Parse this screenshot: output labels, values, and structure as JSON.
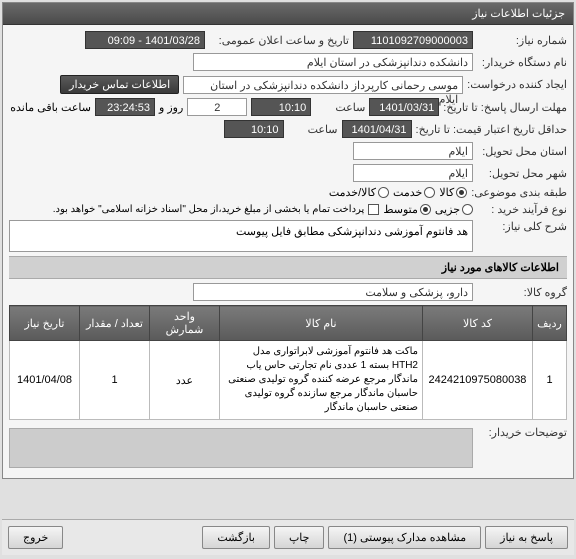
{
  "header": {
    "title": "جزئیات اطلاعات نیاز"
  },
  "fields": {
    "need_no_label": "شماره نیاز:",
    "need_no": "1101092709000003",
    "announce_label": "تاریخ و ساعت اعلان عمومی:",
    "announce_val": "1401/03/28 - 09:09",
    "buyer_label": "نام دستگاه خریدار:",
    "buyer_val": "دانشکده دندانپزشکی در استان ایلام",
    "creator_label": "ایجاد کننده درخواست:",
    "creator_val": "موسی رحمانی کارپرداز دانشکده دندانپزشکی در استان ایلام",
    "contact_btn": "اطلاعات تماس خریدار",
    "deadline_label": "مهلت ارسال پاسخ: تا تاریخ:",
    "deadline_date": "1401/03/31",
    "time_label": "ساعت",
    "deadline_time": "10:10",
    "days_count": "2",
    "days_label": "روز و",
    "countdown": "23:24:53",
    "remain_label": "ساعت باقی مانده",
    "validity_label": "حداقل تاریخ اعتبار قیمت: تا تاریخ:",
    "validity_date": "1401/04/31",
    "validity_time": "10:10",
    "province_label": "استان محل تحویل:",
    "province_val": "ایلام",
    "city_label": "شهر محل تحویل:",
    "city_val": "ایلام",
    "category_label": "طبقه بندی موضوعی:",
    "radio_kala": "کالا",
    "radio_khadamat": "خدمت",
    "radio_kala_khadamat": "کالا/خدمت",
    "process_label": "نوع فرآیند خرید :",
    "radio_jozei": "جزیی",
    "radio_motavaset": "متوسط",
    "payment_note": "پرداخت تمام یا بخشی از مبلغ خرید،از محل \"اسناد خزانه اسلامی\" خواهد بود.",
    "desc_label": "شرح کلی نیاز:",
    "desc_text": "هد فانتوم آموزشی دندانپزشکی مطابق فایل پیوست",
    "items_section": "اطلاعات کالاهای مورد نیاز",
    "group_label": "گروه کالا:",
    "group_val": "دارو، پزشکی و سلامت",
    "buyer_notes_label": "توضیحات خریدار:"
  },
  "table": {
    "headers": [
      "ردیف",
      "کد کالا",
      "نام کالا",
      "واحد شمارش",
      "تعداد / مقدار",
      "تاریخ نیاز"
    ],
    "rows": [
      {
        "idx": "1",
        "code": "2424210975080038",
        "name": "ماکت هد فانتوم آموزشی لابراتواری مدل HTH2 بسته 1 عددی نام تجارتی حاس یاب ماندگار مرجع عرضه کننده گروه تولیدی صنعتی حاسبان ماندگار مرجع سازنده گروه تولیدی صنعتی حاسبان ماندگار",
        "unit": "عدد",
        "qty": "1",
        "date": "1401/04/08"
      }
    ]
  },
  "buttons": {
    "reply": "پاسخ به نیاز",
    "attachments": "مشاهده مدارک پیوستی (1)",
    "print": "چاپ",
    "back": "بازگشت",
    "exit": "خروج"
  }
}
